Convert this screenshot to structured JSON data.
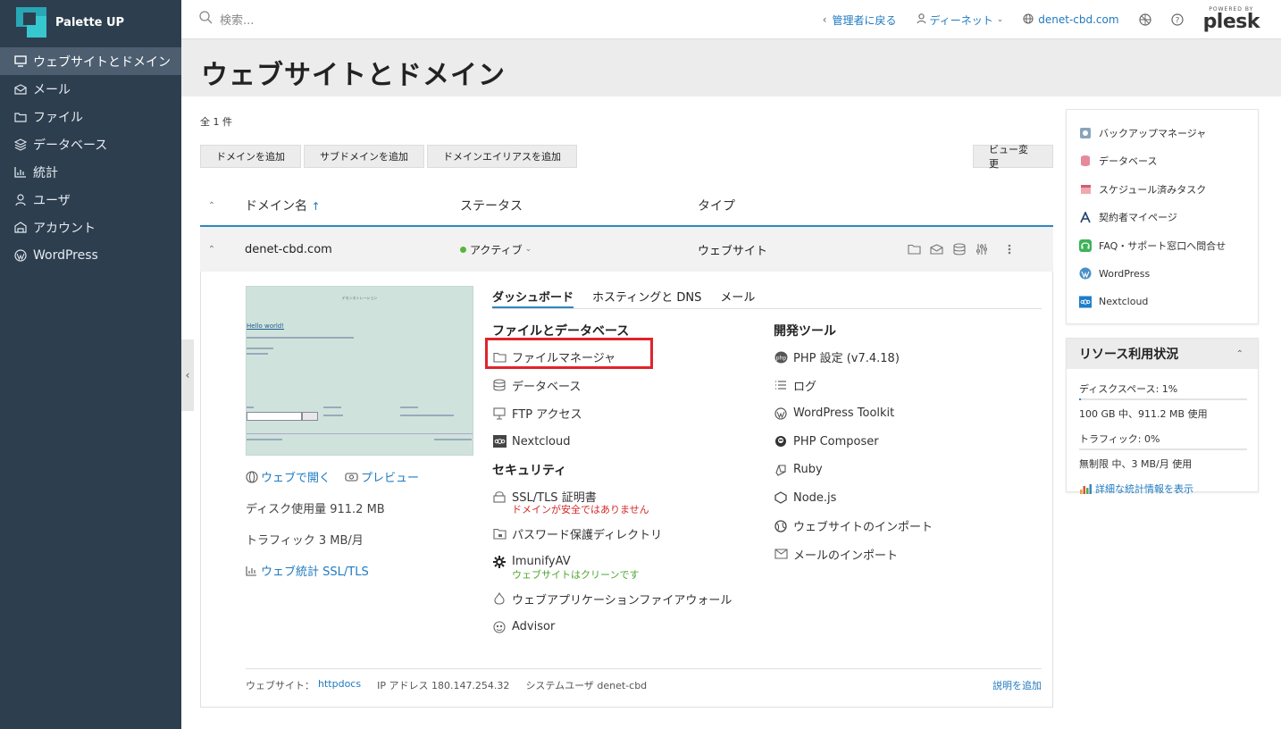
{
  "brand": {
    "name": "Palette UP"
  },
  "sidebar": {
    "items": [
      {
        "label": "ウェブサイトとドメイン",
        "icon": "monitor-icon",
        "active": true
      },
      {
        "label": "メール",
        "icon": "mail-icon"
      },
      {
        "label": "ファイル",
        "icon": "folder-icon"
      },
      {
        "label": "データベース",
        "icon": "database-icon"
      },
      {
        "label": "統計",
        "icon": "chart-icon"
      },
      {
        "label": "ユーザ",
        "icon": "user-icon"
      },
      {
        "label": "アカウント",
        "icon": "account-icon"
      },
      {
        "label": "WordPress",
        "icon": "wordpress-icon"
      }
    ]
  },
  "topbar": {
    "search_placeholder": "検索...",
    "back_to_admin": "管理者に戻る",
    "user": "ディーネット",
    "domain": "denet-cbd.com",
    "powered_by": "POWERED BY",
    "plesk": "plesk"
  },
  "page": {
    "title": "ウェブサイトとドメイン",
    "count": "全 1 件"
  },
  "toolbar": {
    "add_domain": "ドメインを追加",
    "add_subdomain": "サブドメインを追加",
    "add_alias": "ドメインエイリアスを追加",
    "change_view": "ビュー変更"
  },
  "table": {
    "headers": {
      "name": "ドメイン名",
      "sort_arrow": "↑",
      "status": "ステータス",
      "type": "タイプ"
    },
    "row": {
      "domain": "denet-cbd.com",
      "status": "アクティブ",
      "type": "ウェブサイト"
    }
  },
  "thumbnail": {
    "site_title": "デモンストレーション",
    "hello": "Hello world!"
  },
  "domain_info": {
    "open_web": "ウェブで開く",
    "preview": "プレビュー",
    "disk": "ディスク使用量 911.2 MB",
    "traffic": "トラフィック 3 MB/月",
    "web_stats": "ウェブ統計 SSL/TLS"
  },
  "tabs": [
    "ダッシュボード",
    "ホスティングと DNS",
    "メール"
  ],
  "dashboard": {
    "files_db": {
      "title": "ファイルとデータベース",
      "items": [
        "ファイルマネージャ",
        "データベース",
        "FTP アクセス",
        "Nextcloud"
      ]
    },
    "security": {
      "title": "セキュリティ",
      "ssl": "SSL/TLS 証明書",
      "ssl_note": "ドメインが安全ではありません",
      "pwdir": "パスワード保護ディレクトリ",
      "imunify": "ImunifyAV",
      "imunify_note": "ウェブサイトはクリーンです",
      "waf": "ウェブアプリケーションファイアウォール",
      "advisor": "Advisor"
    },
    "dev": {
      "title": "開発ツール",
      "items": [
        "PHP 設定 (v7.4.18)",
        "ログ",
        "WordPress Toolkit",
        "PHP Composer",
        "Ruby",
        "Node.js",
        "ウェブサイトのインポート",
        "メールのインポート"
      ]
    }
  },
  "footer": {
    "website_label": "ウェブサイト：",
    "docroot": "httpdocs",
    "ip": "IP アドレス 180.147.254.32",
    "sysuser": "システムユーザ denet-cbd",
    "add_desc": "説明を追加"
  },
  "right_links": [
    "バックアップマネージャ",
    "データベース",
    "スケジュール済みタスク",
    "契約者マイページ",
    "FAQ・サポート窓口へ問合せ",
    "WordPress",
    "Nextcloud"
  ],
  "resources": {
    "title": "リソース利用状況",
    "disk_label": "ディスクスペース: 1%",
    "disk_fraction": 0.01,
    "disk_detail": "100 GB 中、911.2 MB 使用",
    "traffic_label": "トラフィック: 0%",
    "traffic_fraction": 0.0,
    "traffic_detail": "無制限 中、3 MB/月 使用",
    "stats_link": "詳細な統計情報を表示"
  },
  "colors": {
    "sidebar": "#2d3e4f",
    "accent": "#2f87c0",
    "link": "#1f7ac1",
    "highlight": "#e0232b"
  }
}
